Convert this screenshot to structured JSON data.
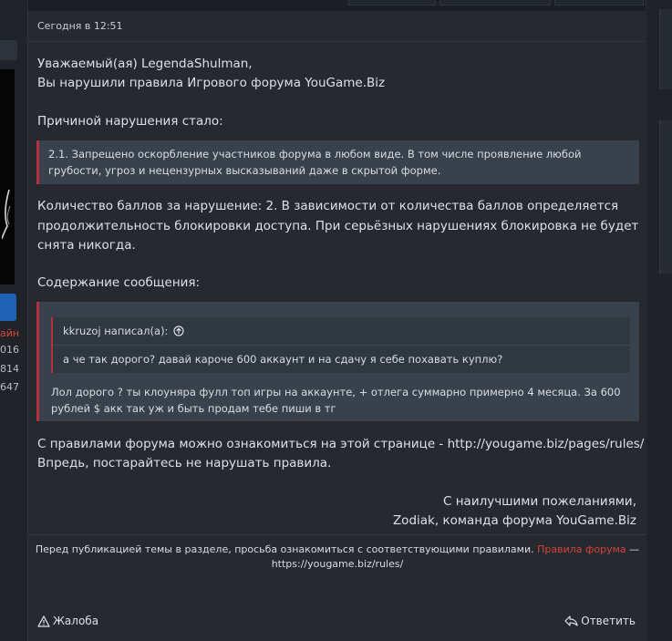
{
  "sidebar": {
    "status": "айн",
    "stats": [
      "016",
      "814",
      "647"
    ]
  },
  "post": {
    "timestamp": "Сегодня в 12:51",
    "greeting": "Уважаемый(ая) LegendaShulman,",
    "violation_line": "Вы нарушили правила Игрового форума YouGame.Biz",
    "reason_label": "Причиной нарушения стало:",
    "rule_lines": [
      "2.1. Запрещено оскорбление участников форума в любом виде. В том числе проявление любой",
      "грубости, угроз и нецензурных высказываний даже в скрытой форме."
    ],
    "points_lines": [
      "Количество баллов за нарушение: 2. В зависимости от количества баллов определяется",
      "продолжительность блокировки доступа. При серьёзных нарушениях блокировка не будет",
      "снята никогда."
    ],
    "content_label": "Содержание сообщения:",
    "quote": {
      "author": "kkruzoj написал(а):",
      "text": "а че так дорого? давай кароче 600 аккаунт и на сдачу я себе похавать куплю?"
    },
    "reply_lines": [
      "Лол дорого ? ты клоуняра фулл топ игры на аккаунте, + отлега суммарно примерно 4 месяца. За 600",
      "рублей $ акк так уж и быть продам тебе пиши в тг"
    ],
    "rules_link_line": "С правилами форума можно ознакомиться на этой странице - http://yougame.biz/pages/rules/",
    "advice_line": "Впредь, постарайтесь не нарушать правила.",
    "signoff_1": "С наилучшими пожеланиями,",
    "signoff_2": "Zodiak, команда форума YouGame.Biz",
    "notice": {
      "text": "Перед публикацией темы в разделе, просьба ознакомиться с соответствующими правилами.",
      "link": "Правила форума",
      "dash": "—",
      "url": "https://yougame.biz/rules/"
    },
    "actions": {
      "report": "Жалоба",
      "reply": "Ответить"
    }
  },
  "colors": {
    "accent_red": "#b6303a",
    "link_red": "#d2433a",
    "post_bg": "#262a30",
    "quote_bg": "#39424c"
  }
}
